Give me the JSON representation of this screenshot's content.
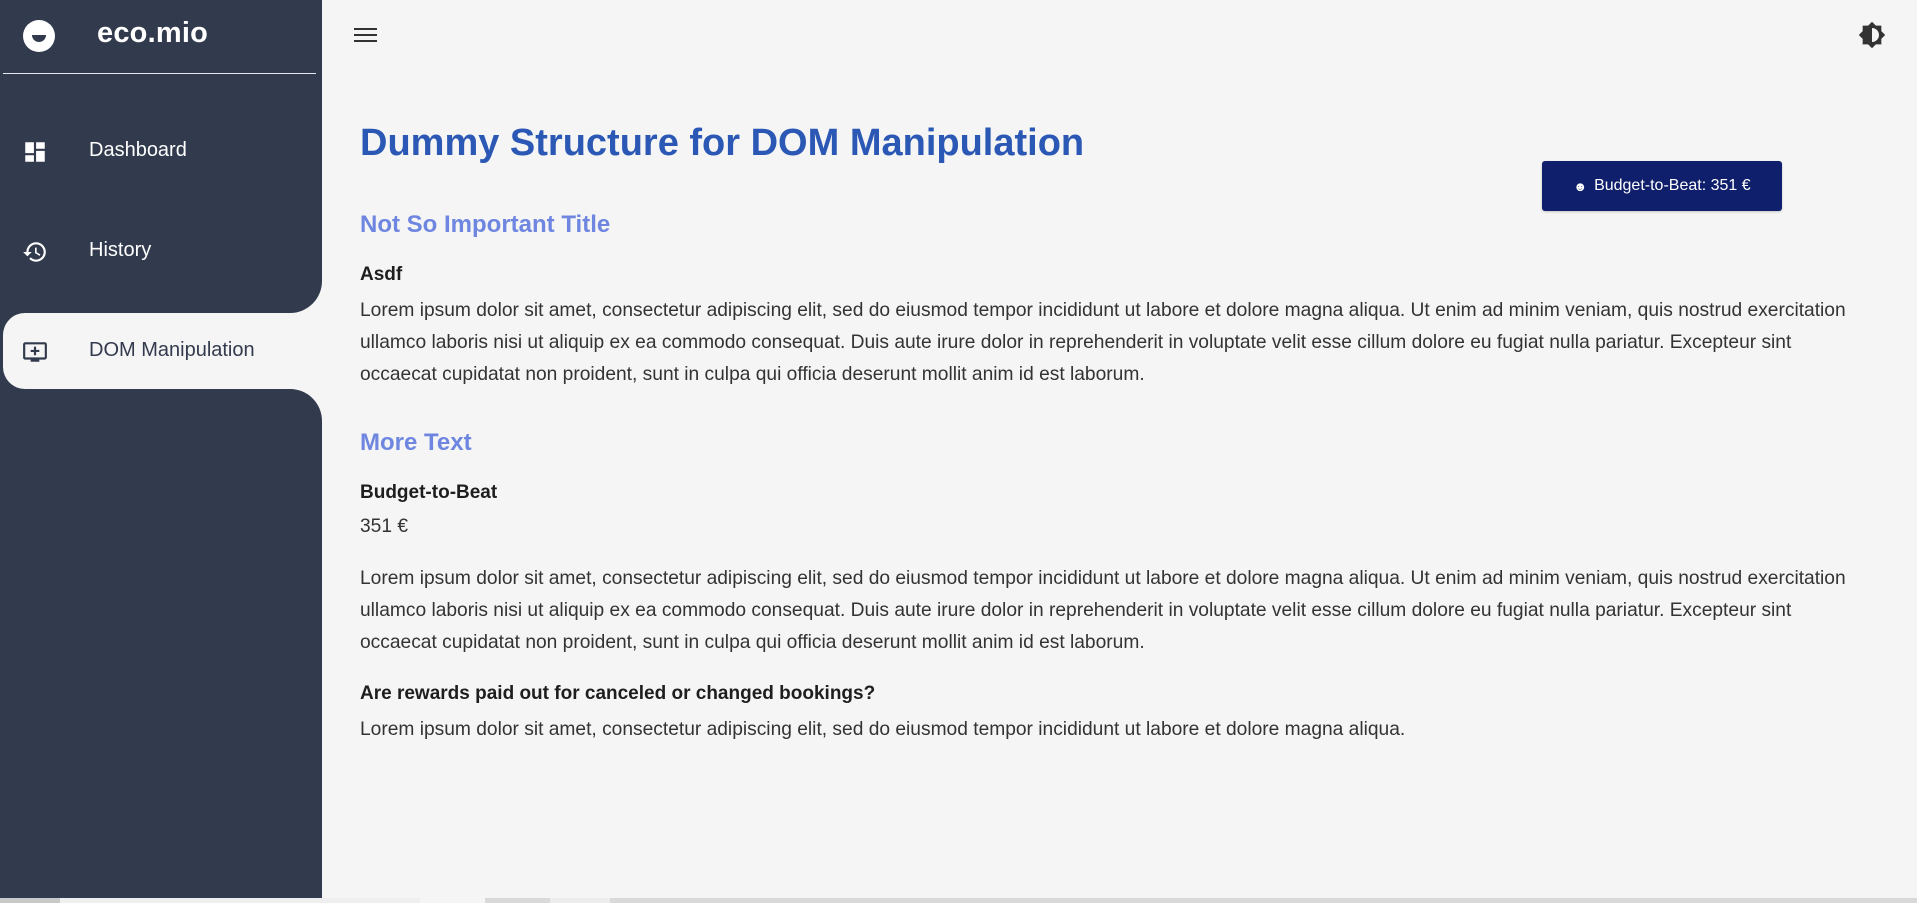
{
  "app": {
    "name": "eco.mio"
  },
  "sidebar": {
    "items": [
      {
        "label": "Dashboard",
        "icon": "dashboard-icon",
        "active": false
      },
      {
        "label": "History",
        "icon": "history-icon",
        "active": false
      },
      {
        "label": "DOM Manipulation",
        "icon": "add-to-queue-icon",
        "active": true
      }
    ]
  },
  "header": {
    "menu_icon": "hamburger-icon",
    "theme_icon": "brightness-icon"
  },
  "main": {
    "title": "Dummy Structure for DOM Manipulation",
    "sections": [
      {
        "title": "Not So Important Title",
        "label": "Asdf",
        "paragraph": "Lorem ipsum dolor sit amet, consectetur adipiscing elit, sed do eiusmod tempor incididunt ut labore et dolore magna aliqua. Ut enim ad minim veniam, quis nostrud exercitation ullamco laboris nisi ut aliquip ex ea commodo consequat. Duis aute irure dolor in reprehenderit in voluptate velit esse cillum dolore eu fugiat nulla pariatur. Excepteur sint occaecat cupidatat non proident, sunt in culpa qui officia deserunt mollit anim id est laborum."
      },
      {
        "title": "More Text",
        "label": "Budget-to-Beat",
        "value": "351 €",
        "paragraph": "Lorem ipsum dolor sit amet, consectetur adipiscing elit, sed do eiusmod tempor incididunt ut labore et dolore magna aliqua. Ut enim ad minim veniam, quis nostrud exercitation ullamco laboris nisi ut aliquip ex ea commodo consequat. Duis aute irure dolor in reprehenderit in voluptate velit esse cillum dolore eu fugiat nulla pariatur. Excepteur sint occaecat cupidatat non proident, sunt in culpa qui officia deserunt mollit anim id est laborum."
      },
      {
        "label": "Are rewards paid out for canceled or changed bookings?",
        "paragraph": "Lorem ipsum dolor sit amet, consectetur adipiscing elit, sed do eiusmod tempor incididunt ut labore et dolore magna aliqua."
      }
    ]
  },
  "budget_button": {
    "icon": "☻",
    "label": "Budget-to-Beat: 351 €"
  },
  "colors": {
    "sidebar_bg": "#323a4d",
    "title": "#2b57b5",
    "section_title": "#6e86e0",
    "button_bg": "#0f1f6b",
    "page_bg": "#f5f5f5"
  }
}
